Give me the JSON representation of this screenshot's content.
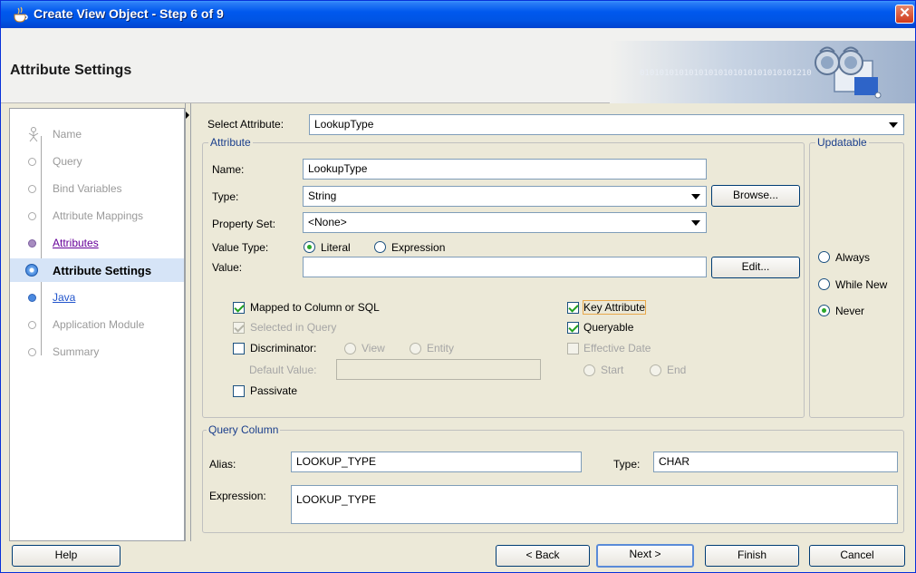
{
  "window": {
    "title": "Create View Object - Step 6 of 9",
    "close_glyph": "✕"
  },
  "header": {
    "heading": "Attribute Settings",
    "binary_text": "01010101010101010101010101010101210"
  },
  "nav": {
    "items": [
      {
        "label": "Name"
      },
      {
        "label": "Query"
      },
      {
        "label": "Bind Variables"
      },
      {
        "label": "Attribute Mappings"
      },
      {
        "label": "Attributes"
      },
      {
        "label": "Attribute Settings"
      },
      {
        "label": "Java"
      },
      {
        "label": "Application Module"
      },
      {
        "label": "Summary"
      }
    ]
  },
  "form": {
    "select_attribute_label": "Select Attribute:",
    "select_attribute_value": "LookupType",
    "attribute_group": "Attribute",
    "name_label": "Name:",
    "name_value": "LookupType",
    "type_label": "Type:",
    "type_value": "String",
    "browse_label": "Browse...",
    "property_set_label": "Property Set:",
    "property_set_value": "<None>",
    "value_type_label": "Value Type:",
    "literal_label": "Literal",
    "expression_radio_label": "Expression",
    "value_label": "Value:",
    "value_value": "",
    "edit_label": "Edit...",
    "mapped_label": "Mapped to Column or SQL",
    "selected_in_query_label": "Selected in Query",
    "discriminator_label": "Discriminator:",
    "view_label": "View",
    "entity_label": "Entity",
    "default_value_label": "Default Value:",
    "passivate_label": "Passivate",
    "key_attribute_label": "Key Attribute",
    "queryable_label": "Queryable",
    "effective_date_label": "Effective Date",
    "start_label": "Start",
    "end_label": "End",
    "updatable_group": "Updatable",
    "always_label": "Always",
    "while_new_label": "While New",
    "never_label": "Never",
    "query_column_group": "Query Column",
    "alias_label": "Alias:",
    "alias_value": "LOOKUP_TYPE",
    "qc_type_label": "Type:",
    "qc_type_value": "CHAR",
    "expression_label": "Expression:",
    "expression_value": "LOOKUP_TYPE"
  },
  "footer": {
    "help": "Help",
    "back": "< Back",
    "next": "Next >",
    "finish": "Finish",
    "cancel": "Cancel"
  }
}
